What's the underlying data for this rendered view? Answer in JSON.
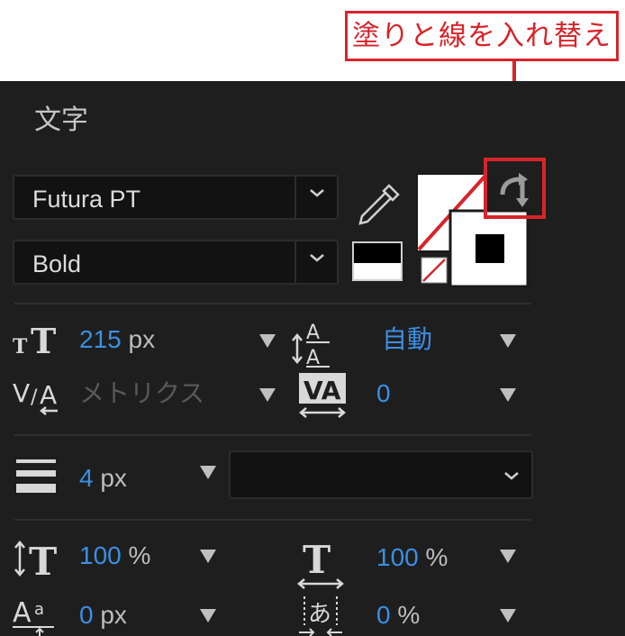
{
  "annotation": {
    "label": "塗りと線を入れ替え"
  },
  "panel": {
    "title": "文字"
  },
  "font": {
    "family": "Futura PT",
    "style": "Bold"
  },
  "size": {
    "value": "215",
    "unit": "px"
  },
  "leading": {
    "value": "自動"
  },
  "kerning": {
    "value": "メトリクス"
  },
  "tracking": {
    "value": "0"
  },
  "stroke": {
    "width": "4",
    "unit": "px"
  },
  "vertical_scale": {
    "value": "100",
    "unit": "%"
  },
  "horizontal_scale": {
    "value": "100",
    "unit": "%"
  },
  "baseline_shift": {
    "value": "0",
    "unit": "px"
  },
  "tsume": {
    "value": "0",
    "unit": "%"
  },
  "colors": {
    "accent_blue": "#3b8fe4",
    "highlight_red": "#d7242a",
    "panel_bg": "#1e1e1e"
  }
}
